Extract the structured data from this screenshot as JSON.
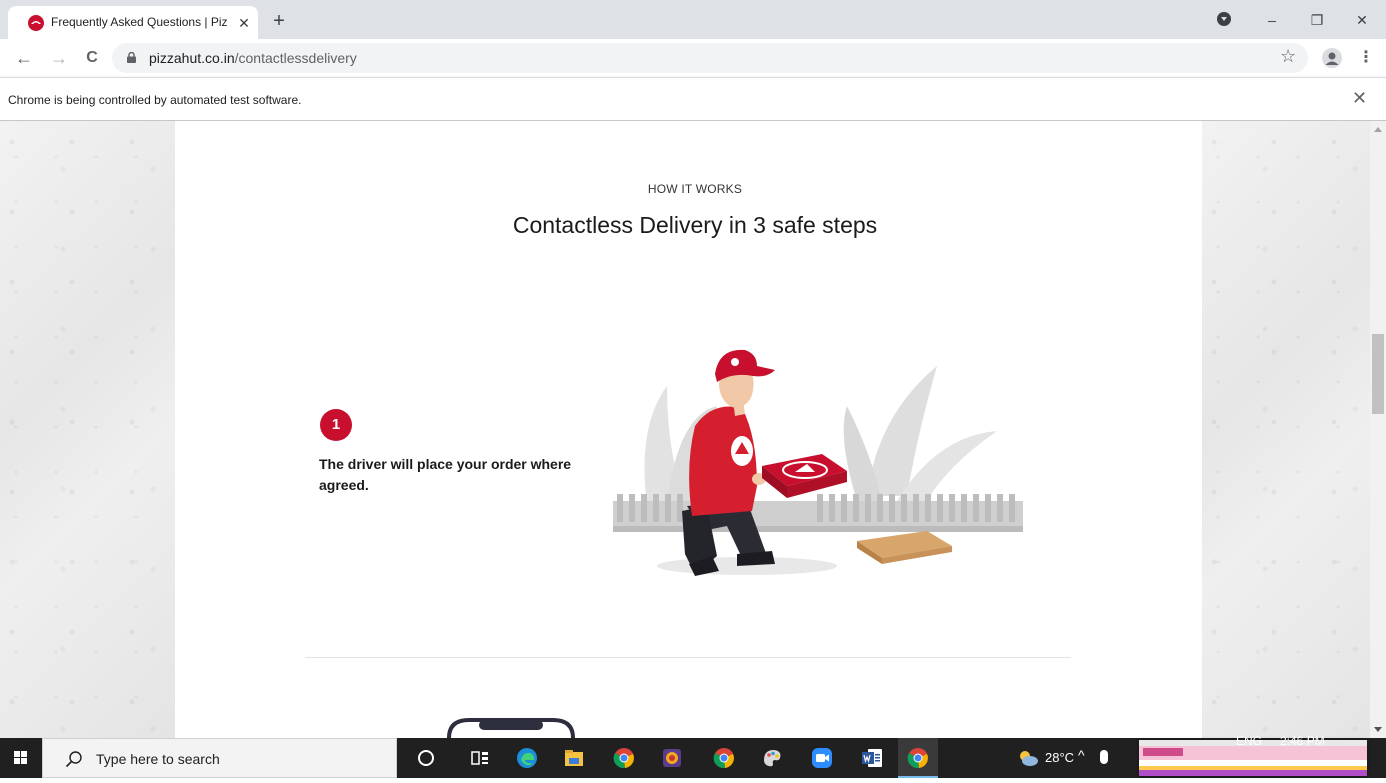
{
  "browser": {
    "tab_title": "Frequently Asked Questions | Piz",
    "tab_close": "✕",
    "new_tab": "+",
    "url_domain": "pizzahut.co.in",
    "url_path": "/contactlessdelivery",
    "infobar_text": "Chrome is being controlled by automated test software.",
    "infobar_close": "✕",
    "window_minimize": "–",
    "window_restore": "❐",
    "window_close": "✕",
    "back": "←",
    "forward": "→",
    "reload": "C",
    "bookmark": "☆",
    "menu": "⋮"
  },
  "page": {
    "eyebrow": "HOW IT WORKS",
    "headline": "Contactless Delivery in 3 safe steps",
    "step_number": "1",
    "step_text": "The driver will place your order where agreed."
  },
  "taskbar": {
    "search_placeholder": "Type here to search",
    "weather_temp": "28°C",
    "tray_up": "^",
    "language": "ENG",
    "time": "2:46 PM"
  },
  "colors": {
    "brand_red": "#c8102e",
    "taskbar": "#202020"
  }
}
